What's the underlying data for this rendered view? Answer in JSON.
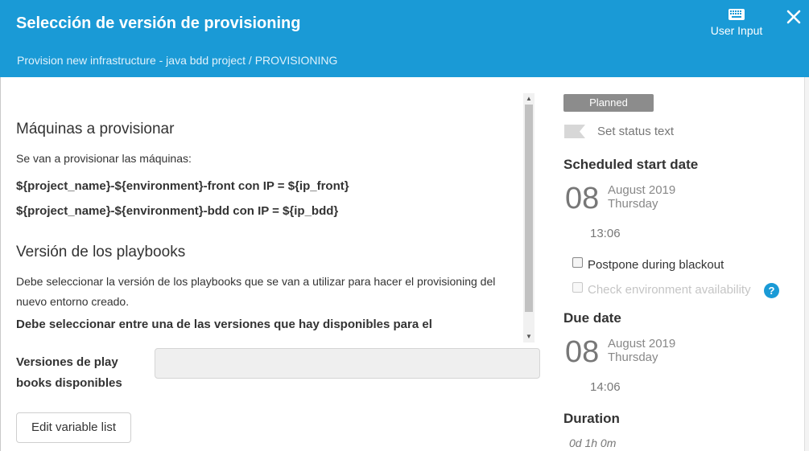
{
  "header": {
    "title": "Selección de versión de provisioning",
    "subtitle": "Provision new infrastructure - java bdd project / PROVISIONING",
    "user_input_label": "User Input",
    "close_icon": "close-icon",
    "keyboard_icon": "keyboard-icon",
    "color": "#1a9ad6"
  },
  "description": {
    "heading1": "Máquinas a provisionar",
    "intro": "Se van a provisionar las máquinas:",
    "machine_front": "${project_name}-${environment}-front con IP = ${ip_front}",
    "machine_bdd": "${project_name}-${environment}-bdd con IP = ${ip_bdd}",
    "heading2": "Versión de los playbooks",
    "paragraph": "Debe seleccionar la versión de los playbooks que se van a utilizar para hacer el provisioning del nuevo entorno creado.",
    "cut_line": "Debe seleccionar entre una de las versiones que hay disponibles para el"
  },
  "form": {
    "field_label": "Versiones de play books disponibles",
    "field_value": "",
    "edit_button_label": "Edit variable list"
  },
  "sidebar": {
    "status_badge": "Planned",
    "status_color": "#8c8c8c",
    "set_status_text": "Set status text",
    "scheduled": {
      "heading": "Scheduled start date",
      "day": "08",
      "month_year": "August 2019",
      "weekday": "Thursday",
      "time": "13:06"
    },
    "postpone_label": "Postpone during blackout",
    "check_env_label": "Check environment availability",
    "help_glyph": "?",
    "due": {
      "heading": "Due date",
      "day": "08",
      "month_year": "August 2019",
      "weekday": "Thursday",
      "time": "14:06"
    },
    "duration": {
      "heading": "Duration",
      "value": "0d 1h 0m"
    }
  }
}
